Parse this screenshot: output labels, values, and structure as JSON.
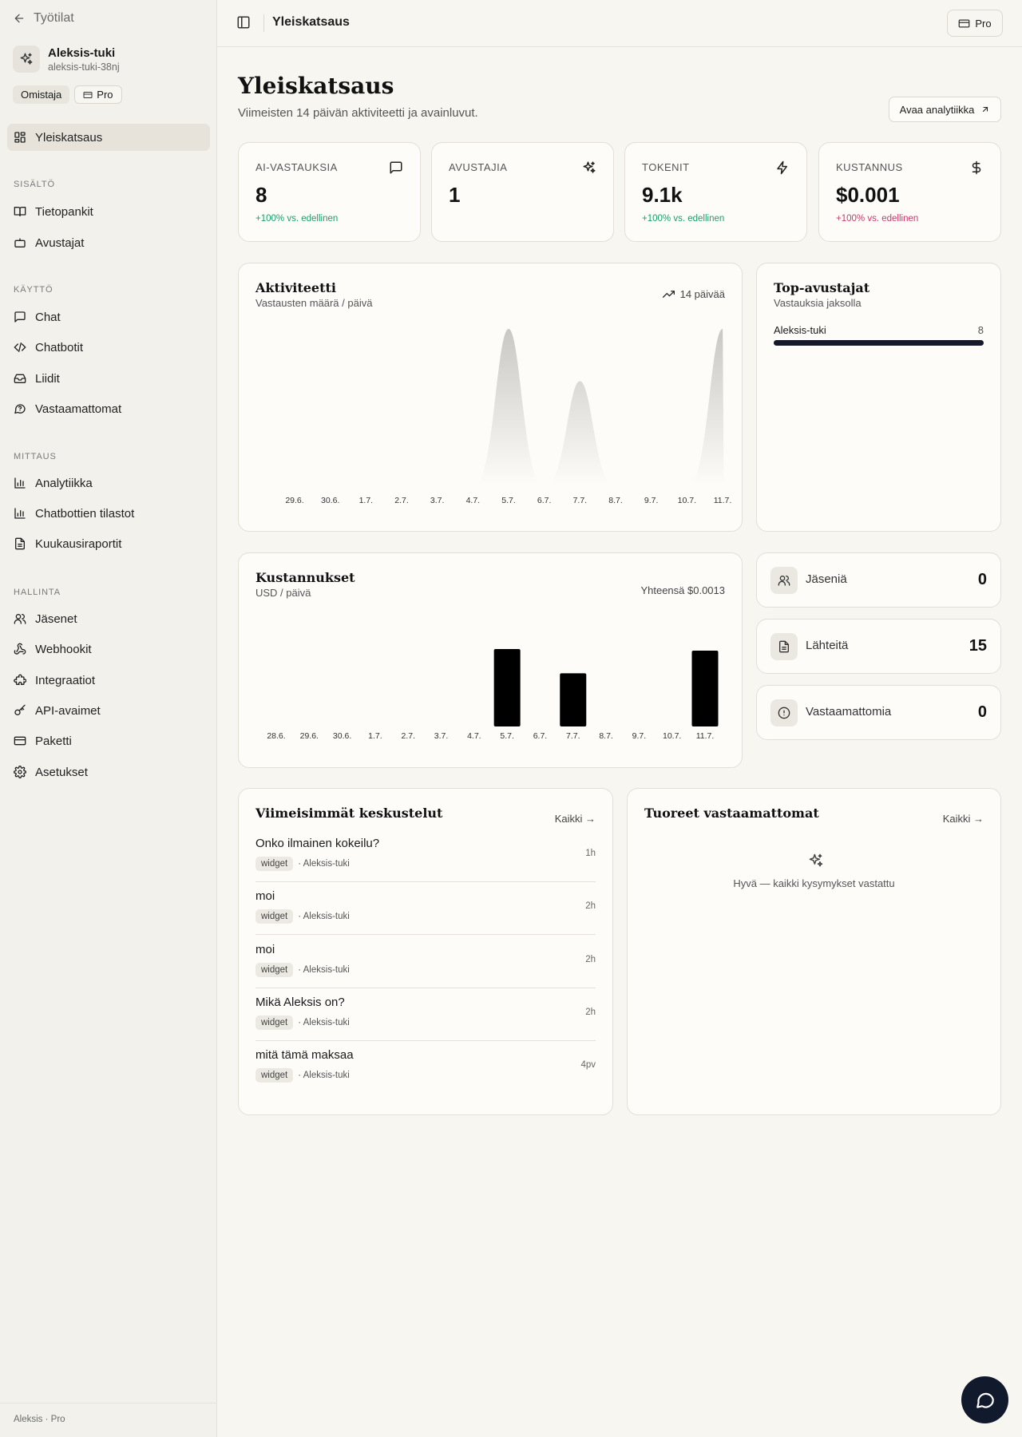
{
  "sidebar": {
    "back_label": "Työtilat",
    "workspace": {
      "name": "Aleksis-tuki",
      "slug": "aleksis-tuki-38nj",
      "role_badge": "Omistaja",
      "plan_badge": "Pro"
    },
    "overview_label": "Yleiskatsaus",
    "sections": [
      {
        "title": "SISÄLTÖ",
        "items": [
          "Tietopankit",
          "Avustajat"
        ]
      },
      {
        "title": "KÄYTTÖ",
        "items": [
          "Chat",
          "Chatbotit",
          "Liidit",
          "Vastaamattomat"
        ]
      },
      {
        "title": "MITTAUS",
        "items": [
          "Analytiikka",
          "Chatbottien tilastot",
          "Kuukausiraportit"
        ]
      },
      {
        "title": "HALLINTA",
        "items": [
          "Jäsenet",
          "Webhookit",
          "Integraatiot",
          "API-avaimet",
          "Paketti",
          "Asetukset"
        ]
      }
    ],
    "footer": "Aleksis · Pro"
  },
  "topbar": {
    "title": "Yleiskatsaus",
    "plan_button": "Pro"
  },
  "page": {
    "title": "Yleiskatsaus",
    "subtitle": "Viimeisten 14 päivän aktiviteetti ja avainluvut.",
    "open_analytics": "Avaa analytiikka"
  },
  "stats": [
    {
      "label": "AI-VASTAUKSIA",
      "value": "8",
      "delta": "+100% vs. edellinen",
      "icon": "message-icon"
    },
    {
      "label": "AVUSTAJIA",
      "value": "1",
      "delta": "",
      "icon": "sparkles-icon"
    },
    {
      "label": "TOKENIT",
      "value": "9.1k",
      "delta": "+100% vs. edellinen",
      "icon": "bolt-icon"
    },
    {
      "label": "KUSTANNUS",
      "value": "$0.001",
      "delta": "+100% vs. edellinen",
      "icon": "dollar-icon"
    }
  ],
  "activity": {
    "title": "Aktiviteetti",
    "subtitle": "Vastausten määrä / päivä",
    "range_label": "14 päivää",
    "chart_data": {
      "type": "area",
      "x": [
        "29.6.",
        "30.6.",
        "1.7.",
        "2.7.",
        "3.7.",
        "4.7.",
        "5.7.",
        "6.7.",
        "7.7.",
        "8.7.",
        "9.7.",
        "10.7.",
        "11.7."
      ],
      "values": [
        0,
        0,
        0,
        0,
        0,
        0,
        3,
        0,
        2,
        0,
        0,
        0,
        3
      ],
      "grid": false
    }
  },
  "top_assistants": {
    "title": "Top-avustajat",
    "subtitle": "Vastauksia jaksolla",
    "rows": [
      {
        "name": "Aleksis-tuki",
        "value": "8",
        "share": 1.0
      }
    ]
  },
  "costs": {
    "title": "Kustannukset",
    "subtitle": "USD / päivä",
    "total_label": "Yhteensä $0.0013",
    "chart_data": {
      "type": "bar",
      "categories": [
        "28.6.",
        "29.6.",
        "30.6.",
        "1.7.",
        "2.7.",
        "3.7.",
        "4.7.",
        "5.7.",
        "6.7.",
        "7.7.",
        "8.7.",
        "9.7.",
        "10.7.",
        "11.7."
      ],
      "values": [
        0,
        0,
        0,
        0,
        0,
        0,
        0,
        0.00048,
        0,
        0.00033,
        0,
        0,
        0,
        0.00047
      ],
      "grid": false
    }
  },
  "mini_stats": [
    {
      "label": "Jäseniä",
      "value": "0",
      "icon": "users-icon"
    },
    {
      "label": "Lähteitä",
      "value": "15",
      "icon": "document-icon"
    },
    {
      "label": "Vastaamattomia",
      "value": "0",
      "icon": "alert-icon"
    }
  ],
  "recent": {
    "title": "Viimeisimmät keskustelut",
    "all_link": "Kaikki →",
    "items": [
      {
        "title": "Onko ilmainen kokeilu?",
        "tag": "widget",
        "assistant": "· Aleksis-tuki",
        "time": "1h"
      },
      {
        "title": "moi",
        "tag": "widget",
        "assistant": "· Aleksis-tuki",
        "time": "2h"
      },
      {
        "title": "moi",
        "tag": "widget",
        "assistant": "· Aleksis-tuki",
        "time": "2h"
      },
      {
        "title": "Mikä Aleksis on?",
        "tag": "widget",
        "assistant": "· Aleksis-tuki",
        "time": "2h"
      },
      {
        "title": "mitä tämä maksaa",
        "tag": "widget",
        "assistant": "· Aleksis-tuki",
        "time": "4pv"
      }
    ]
  },
  "unanswered": {
    "title": "Tuoreet vastaamattomat",
    "all_link": "Kaikki →",
    "empty_text": "Hyvä — kaikki kysymykset vastattu"
  }
}
